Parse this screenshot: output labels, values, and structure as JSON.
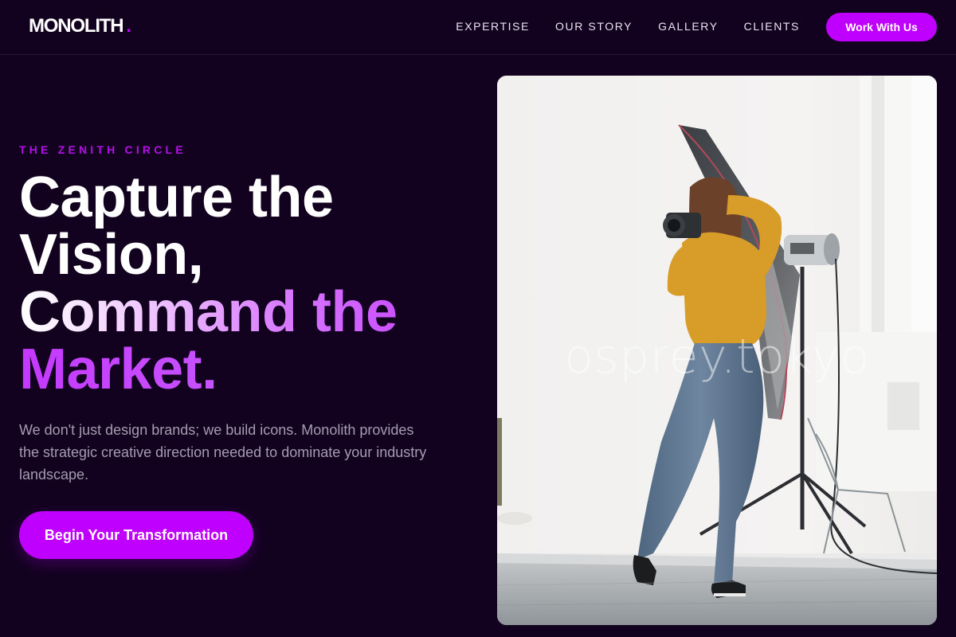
{
  "brand": {
    "name": "MONOLITH",
    "dot": ".",
    "accent_color": "#c000ff",
    "background": "#12021f"
  },
  "nav": {
    "links": [
      "EXPERTISE",
      "OUR STORY",
      "GALLERY",
      "CLIENTS"
    ],
    "cta_label": "Work With Us"
  },
  "hero": {
    "eyebrow": "THE ZENITH CIRCLE",
    "headline": {
      "line1": "Capture the",
      "line2": "Vision,",
      "line3": "Command the",
      "line4": "Market."
    },
    "body": "We don't just design brands; we build icons. Monolith provides the strategic creative direction needed to dominate your industry landscape.",
    "cta_label": "Begin Your Transformation",
    "image": {
      "subject": "photographer-in-studio",
      "watermark": "osprey.tokyo"
    }
  }
}
